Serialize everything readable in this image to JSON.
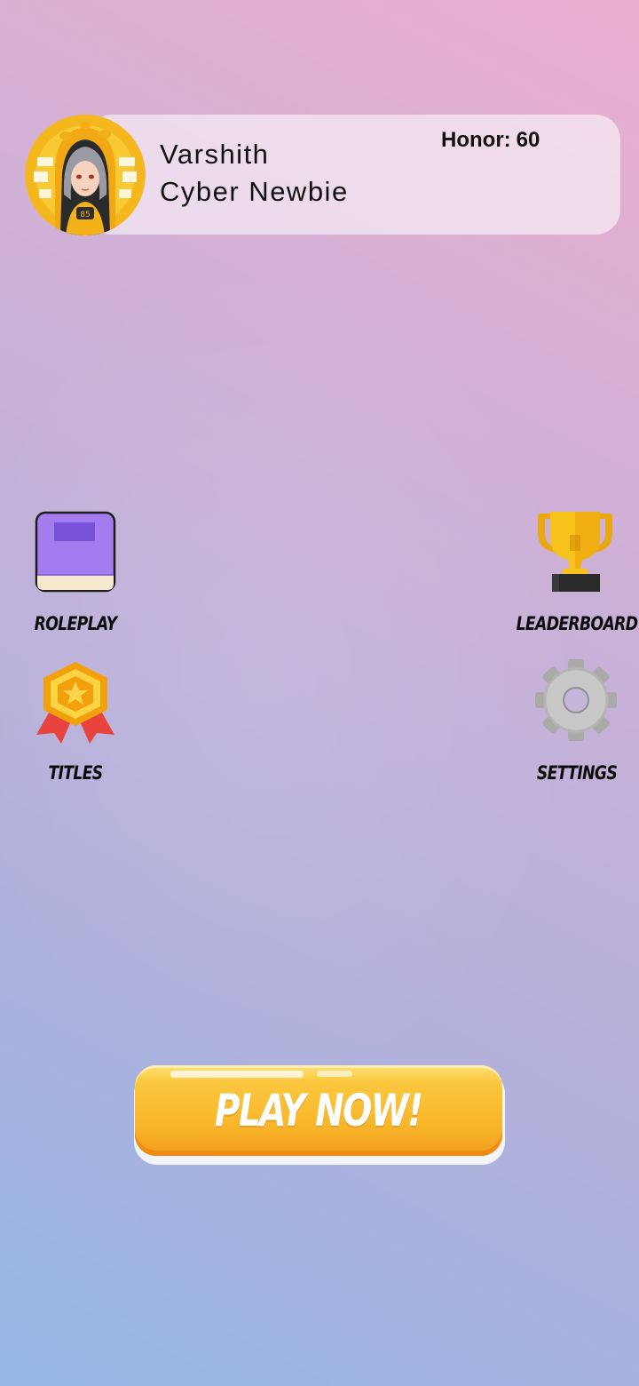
{
  "profile": {
    "name": "Varshith",
    "title": "Cyber Newbie",
    "honor_label": "Honor:",
    "honor_value": "60"
  },
  "menu": {
    "roleplay": {
      "label": "ROLEPLAY",
      "icon": "book-icon"
    },
    "leaderboard": {
      "label": "LEADERBOARD",
      "icon": "trophy-icon"
    },
    "titles": {
      "label": "TITLES",
      "icon": "medal-icon"
    },
    "settings": {
      "label": "SETTINGS",
      "icon": "gear-icon"
    }
  },
  "play_button": {
    "label": "PLAY NOW!"
  },
  "colors": {
    "background_bottom_left": "#94b6e6",
    "background_top_right": "#ebaece",
    "play_button": "#f9b82c",
    "book": "#a57cf0",
    "trophy": "#f7c21c",
    "medal_ribbon": "#e8443d",
    "gear": "#c4c4c4"
  }
}
